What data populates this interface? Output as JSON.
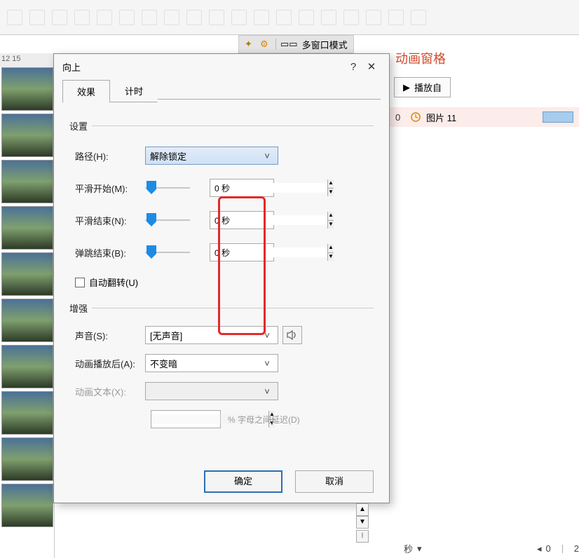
{
  "utility": {
    "multi_window": "多窗口模式"
  },
  "slide_nums": "12  15",
  "anim_pane": {
    "title": "动画窗格",
    "play": "播放自",
    "item_idx": "0",
    "item_label": "图片 11"
  },
  "dialog": {
    "title": "向上",
    "help": "?",
    "tabs": {
      "effect": "效果",
      "timing": "计时"
    },
    "settings": {
      "header": "设置",
      "path_label": "路径(H):",
      "path_value": "解除锁定",
      "smooth_start_label": "平滑开始(M):",
      "smooth_start_value": "0 秒",
      "smooth_end_label": "平滑结束(N):",
      "smooth_end_value": "0 秒",
      "bounce_end_label": "弹跳结束(B):",
      "bounce_end_value": "0 秒",
      "auto_reverse": "自动翻转(U)"
    },
    "enhance": {
      "header": "增强",
      "sound_label": "声音(S):",
      "sound_value": "[无声音]",
      "after_label": "动画播放后(A):",
      "after_value": "不变暗",
      "text_label": "动画文本(X):",
      "delay_text": "% 字母之间延迟(D)"
    },
    "ok": "确定",
    "cancel": "取消"
  },
  "axis": {
    "unit": "秒",
    "p0": "0",
    "p2": "2"
  }
}
